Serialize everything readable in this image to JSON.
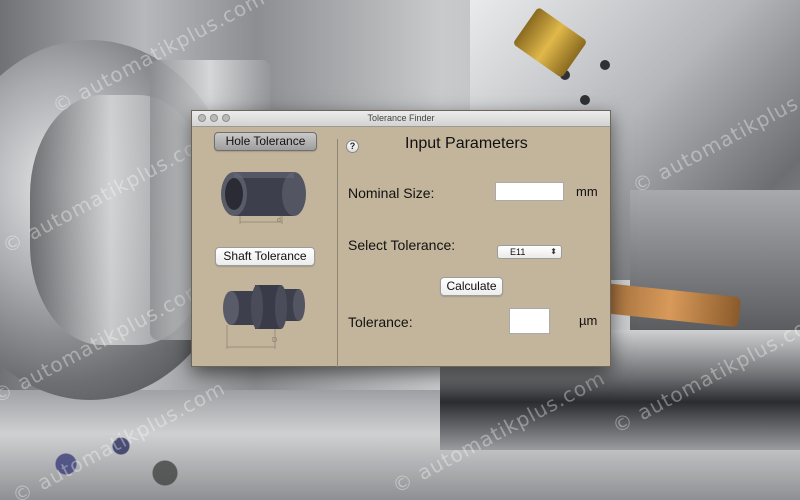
{
  "window": {
    "title": "Tolerance Finder"
  },
  "sidebar": {
    "hole_button": "Hole Tolerance",
    "shaft_button": "Shaft Tolerance",
    "hole_dim_label": "d",
    "shaft_dim_label": "D"
  },
  "main": {
    "help_glyph": "?",
    "heading": "Input Parameters",
    "nominal_label": "Nominal Size:",
    "nominal_value": "",
    "nominal_unit": "mm",
    "select_label": "Select Tolerance:",
    "select_value": "E11",
    "calculate_button": "Calculate",
    "tolerance_label": "Tolerance:",
    "tolerance_value": "",
    "tolerance_unit": "µm"
  },
  "background": {
    "watermark": "© automatikplus.com"
  },
  "colors": {
    "panel": "#c2b59b",
    "window_border": "#6b655a",
    "part_dark": "#3e3f4c"
  }
}
